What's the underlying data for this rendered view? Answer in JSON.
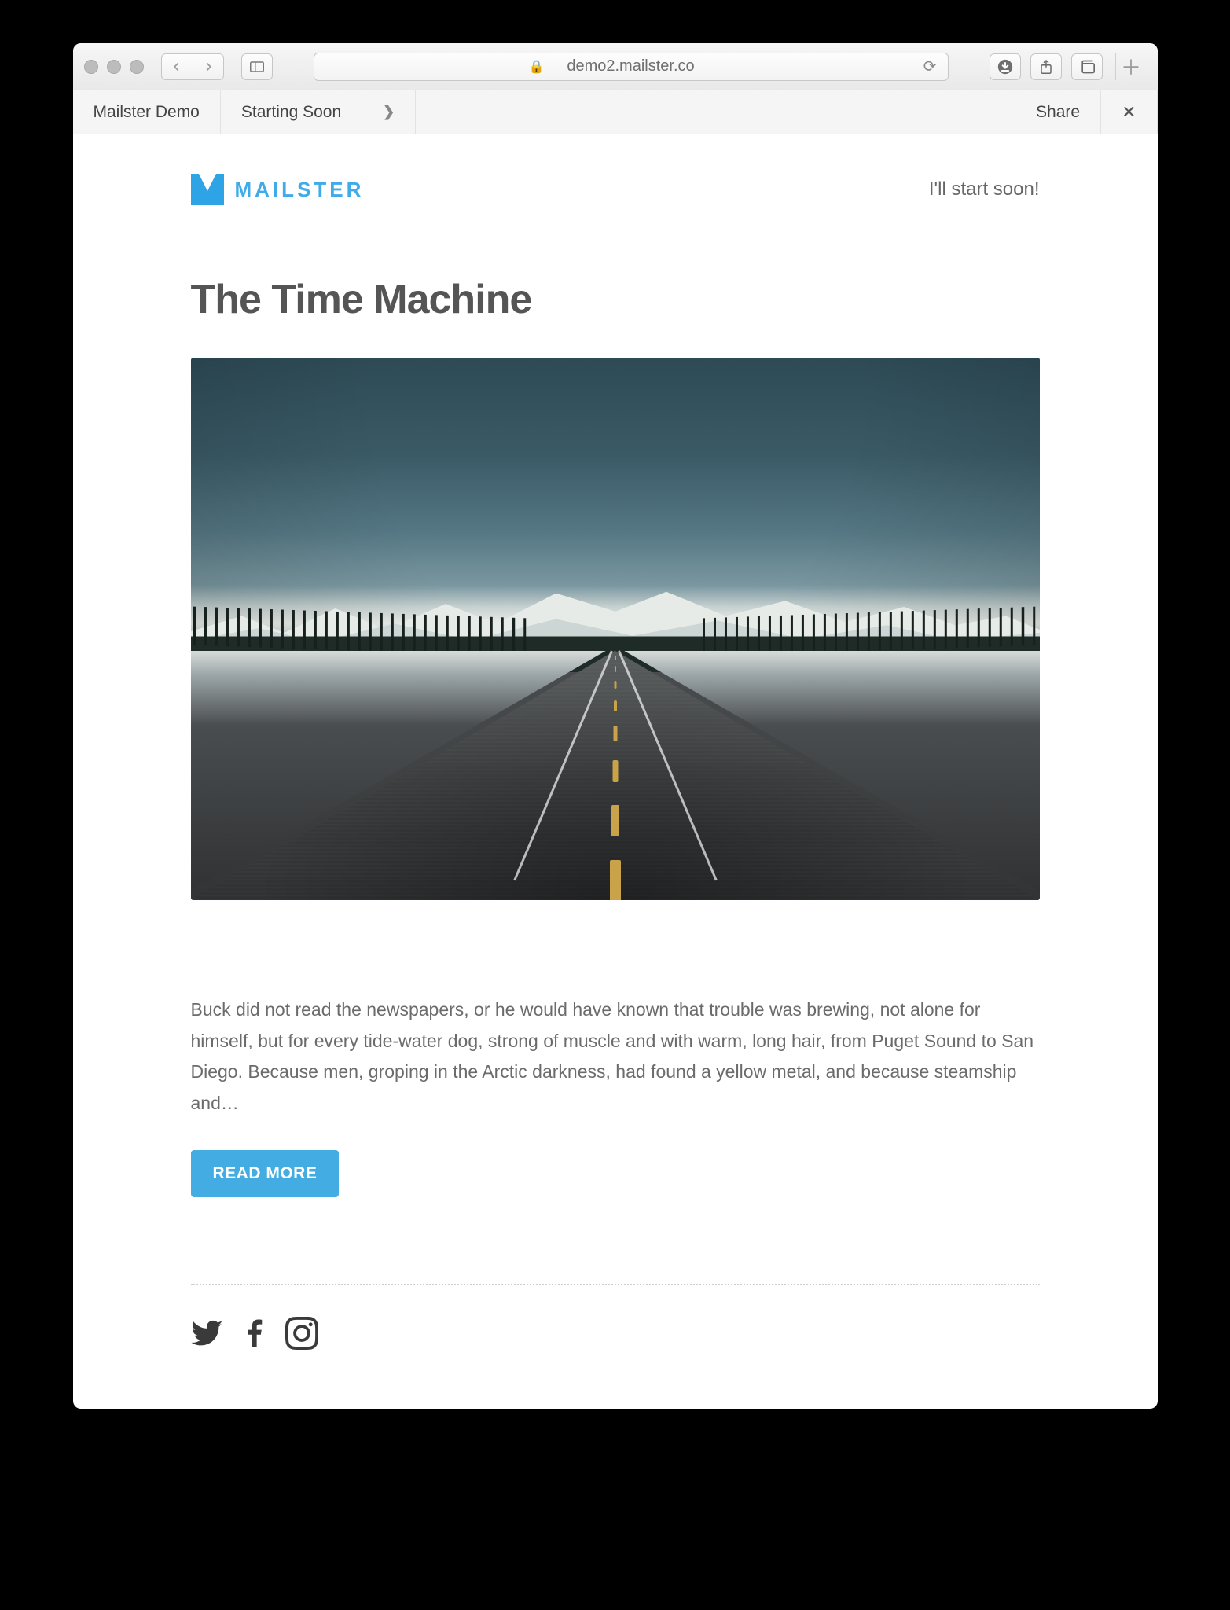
{
  "browser": {
    "address": "demo2.mailster.co"
  },
  "tabs": {
    "left": [
      "Mailster Demo",
      "Starting Soon"
    ],
    "chevron": "❯",
    "share": "Share",
    "close": "✕"
  },
  "header": {
    "brand": "MAILSTER",
    "tagline": "I'll start soon!"
  },
  "article": {
    "title": "The Time Machine",
    "body": "Buck did not read the newspapers, or he would have known that trouble was brewing, not alone for himself, but for every tide-water dog, strong of muscle and with warm, long hair, from Puget Sound to San Diego. Because men, groping in the Arctic darkness, had found a yellow metal, and because steamship and…",
    "cta": "READ MORE"
  },
  "social": {
    "items": [
      "twitter",
      "facebook",
      "instagram"
    ]
  },
  "image": {
    "alt": "Empty highway heading toward snow-capped mountains"
  }
}
